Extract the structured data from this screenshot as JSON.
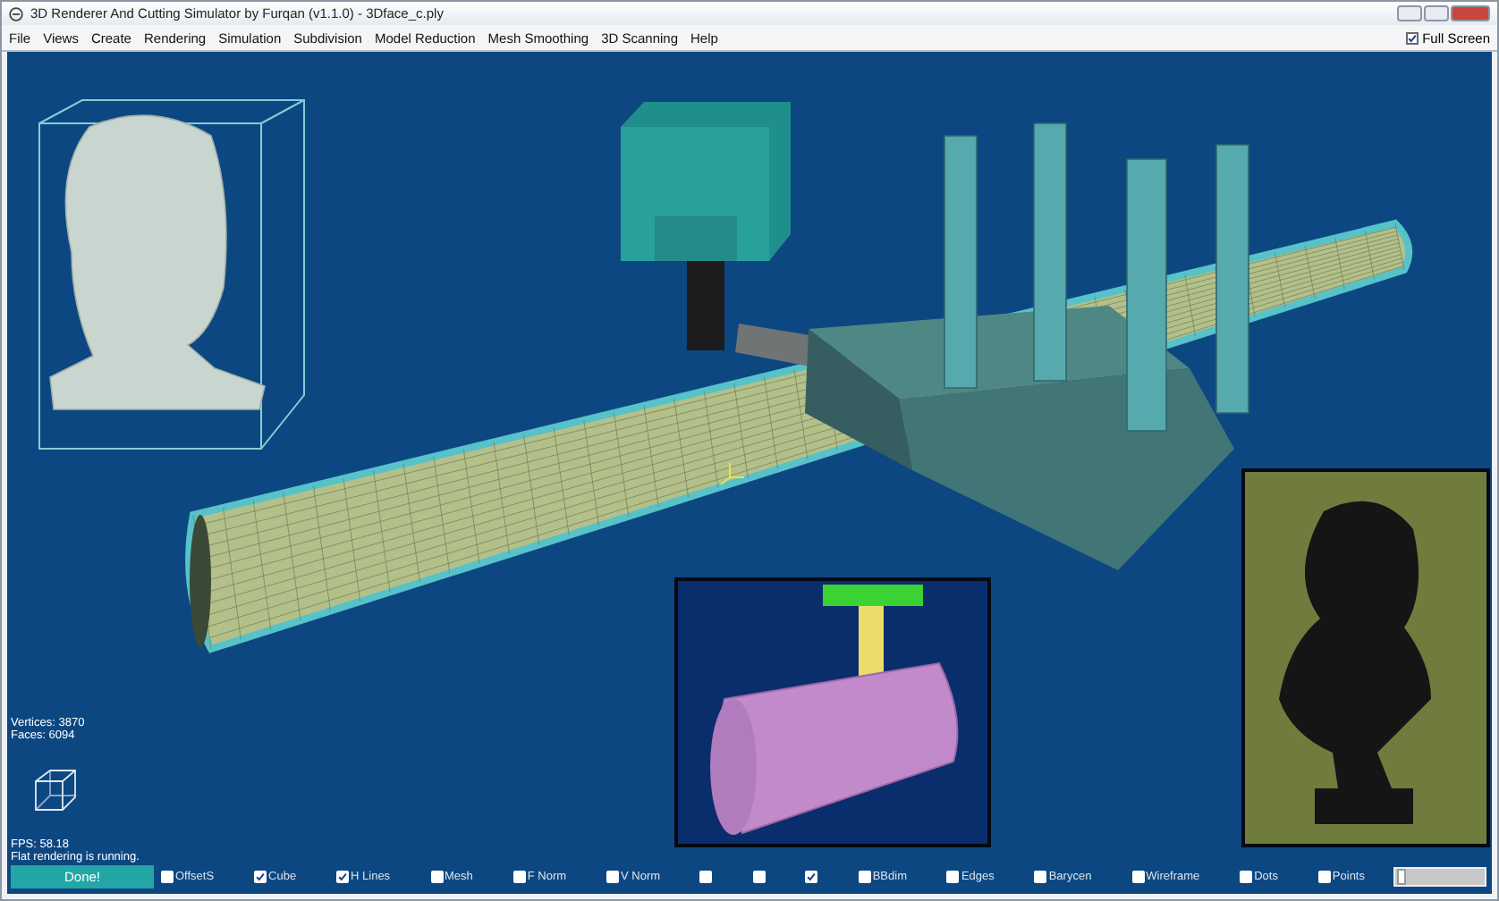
{
  "window": {
    "title": "3D Renderer And Cutting Simulator by Furqan (v1.1.0) - 3Dface_c.ply"
  },
  "menu": [
    "File",
    "Views",
    "Create",
    "Rendering",
    "Simulation",
    "Subdivision",
    "Model Reduction",
    "Mesh Smoothing",
    "3D Scanning",
    "Help"
  ],
  "full_screen": {
    "label": "Full Screen",
    "checked": true
  },
  "stats": {
    "vertices": "Vertices: 3870",
    "faces": "Faces: 6094",
    "fps": "FPS: 58.18",
    "status": "Flat rendering is running."
  },
  "done_button": "Done!",
  "options": [
    {
      "label": "OffsetS",
      "checked": false
    },
    {
      "label": "Cube",
      "checked": true
    },
    {
      "label": "H Lines",
      "checked": true
    },
    {
      "label": "Mesh",
      "checked": false
    },
    {
      "label": "F Norm",
      "checked": false
    },
    {
      "label": "V Norm",
      "checked": false
    },
    {
      "checked": false
    },
    {
      "checked": false
    },
    {
      "checked": true
    },
    {
      "label": "BBdim",
      "checked": false
    },
    {
      "label": "Edges",
      "checked": false
    },
    {
      "label": "Barycen",
      "checked": false
    },
    {
      "label": "Wireframe",
      "checked": false
    },
    {
      "label": "Dots",
      "checked": false
    },
    {
      "label": "Points",
      "checked": false
    }
  ],
  "slider": {
    "level": 0.02
  }
}
